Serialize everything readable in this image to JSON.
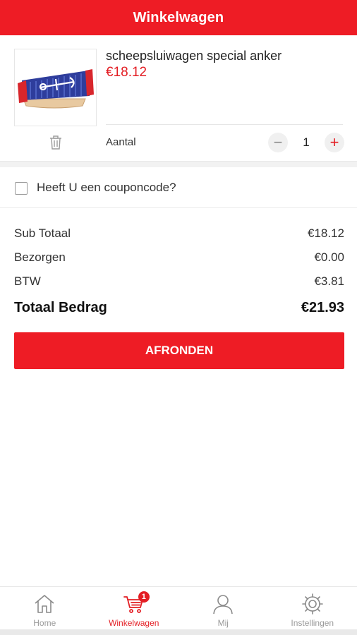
{
  "header": {
    "title": "Winkelwagen"
  },
  "cart_item": {
    "name": "scheepsluiwagen special anker",
    "price": "€18.12",
    "quantity_label": "Aantal",
    "quantity": "1",
    "minus_symbol": "−",
    "plus_symbol": "+"
  },
  "coupon": {
    "label": "Heeft U een couponcode?"
  },
  "totals": {
    "rows": [
      {
        "label": "Sub Totaal",
        "value": "€18.12"
      },
      {
        "label": "Bezorgen",
        "value": "€0.00"
      },
      {
        "label": "BTW",
        "value": "€3.81"
      }
    ],
    "total_label": "Totaal Bedrag",
    "total_value": "€21.93"
  },
  "checkout_button": {
    "label": "AFRONDEN"
  },
  "bottom_nav": {
    "items": [
      {
        "label": "Home",
        "icon": "home-icon",
        "active": false
      },
      {
        "label": "Winkelwagen",
        "icon": "cart-icon",
        "active": true,
        "badge": "1"
      },
      {
        "label": "Mij",
        "icon": "user-icon",
        "active": false
      },
      {
        "label": "Instellingen",
        "icon": "gear-icon",
        "active": false
      }
    ]
  },
  "colors": {
    "accent": "#ee1c25",
    "price": "#e31e24",
    "inactive": "#9a9a9a"
  }
}
